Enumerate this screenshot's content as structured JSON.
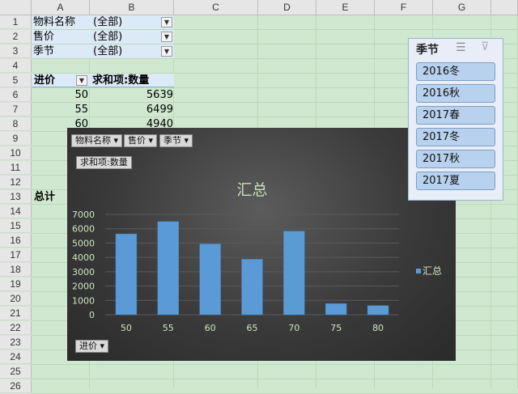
{
  "columns": [
    "A",
    "B",
    "C",
    "D",
    "E",
    "F",
    "G"
  ],
  "rows": [
    "1",
    "2",
    "3",
    "4",
    "5",
    "6",
    "7",
    "8",
    "9",
    "10",
    "11",
    "12",
    "13",
    "14",
    "15",
    "16",
    "17",
    "18",
    "19",
    "20",
    "21",
    "22",
    "23",
    "24",
    "25",
    "26"
  ],
  "filters": [
    {
      "label": "物料名称",
      "value": "(全部)"
    },
    {
      "label": "售价",
      "value": "(全部)"
    },
    {
      "label": "季节",
      "value": "(全部)"
    }
  ],
  "pivot": {
    "row_header": "进价",
    "value_header": "求和项:数量",
    "rows": [
      {
        "key": "50",
        "value": "5639"
      },
      {
        "key": "55",
        "value": "6499"
      },
      {
        "key": "60",
        "value": "4940"
      }
    ],
    "total_label": "总计"
  },
  "chart_buttons": {
    "filter1": "物料名称",
    "filter2": "售价",
    "filter3": "季节",
    "value_field": "求和项:数量",
    "axis_field": "进价"
  },
  "chart_data": {
    "type": "bar",
    "title": "汇总",
    "categories": [
      "50",
      "55",
      "60",
      "65",
      "70",
      "75",
      "80"
    ],
    "series": [
      {
        "name": "汇总",
        "values": [
          5639,
          6499,
          4940,
          3870,
          5830,
          780,
          640
        ]
      }
    ],
    "ylim": [
      0,
      7000
    ],
    "yticks": [
      "0",
      "1000",
      "2000",
      "3000",
      "4000",
      "5000",
      "6000",
      "7000"
    ],
    "legend": "right",
    "grid": true
  },
  "slicer": {
    "title": "季节",
    "items": [
      "2016冬",
      "2016秋",
      "2017春",
      "2017冬",
      "2017秋",
      "2017夏"
    ]
  },
  "colors": {
    "bar": "#5b9bd5",
    "chart_bg": "#3a3a3a",
    "sheet_bg": "#cfe8cf",
    "slicer_item": "#b7d1ee"
  }
}
